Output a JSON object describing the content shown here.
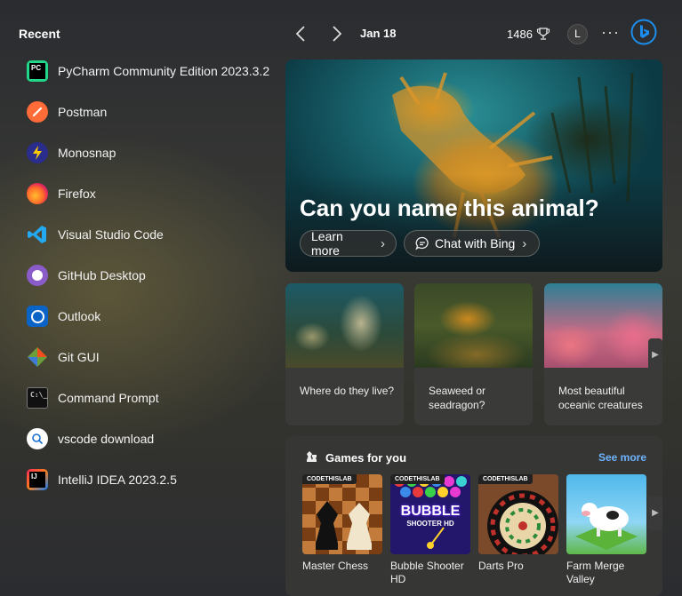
{
  "recent": {
    "title": "Recent",
    "items": [
      {
        "label": "PyCharm Community Edition 2023.3.2",
        "icon": "pycharm-icon"
      },
      {
        "label": "Postman",
        "icon": "postman-icon"
      },
      {
        "label": "Monosnap",
        "icon": "monosnap-icon"
      },
      {
        "label": "Firefox",
        "icon": "firefox-icon"
      },
      {
        "label": "Visual Studio Code",
        "icon": "vscode-icon"
      },
      {
        "label": "GitHub Desktop",
        "icon": "github-desktop-icon"
      },
      {
        "label": "Outlook",
        "icon": "outlook-icon"
      },
      {
        "label": "Git GUI",
        "icon": "git-gui-icon"
      },
      {
        "label": "Command Prompt",
        "icon": "command-prompt-icon"
      },
      {
        "label": "vscode download",
        "icon": "search-icon"
      },
      {
        "label": "IntelliJ IDEA 2023.2.5",
        "icon": "intellij-icon"
      }
    ]
  },
  "header": {
    "date": "Jan 18",
    "points": "1486",
    "avatar_initial": "L",
    "more": "···"
  },
  "hero": {
    "title": "Can you name this animal?",
    "learn_more": "Learn more",
    "chat_with_bing": "Chat with Bing"
  },
  "cards": [
    {
      "text": "Where do they live?"
    },
    {
      "text": "Seaweed or seadragon?"
    },
    {
      "text": "Most beautiful oceanic creatures"
    }
  ],
  "games": {
    "title": "Games for you",
    "see_more": "See more",
    "badge": "CODETHISLAB",
    "items": [
      {
        "name": "Master Chess"
      },
      {
        "name": "Bubble Shooter HD"
      },
      {
        "name": "Darts Pro"
      },
      {
        "name": "Farm Merge Valley"
      }
    ],
    "bubble_logo_line1": "BUBBLE",
    "bubble_logo_line2": "SHOOTER HD"
  },
  "colors": {
    "accent_link": "#6fb4ff",
    "bing_blue": "#1b8ef0"
  }
}
